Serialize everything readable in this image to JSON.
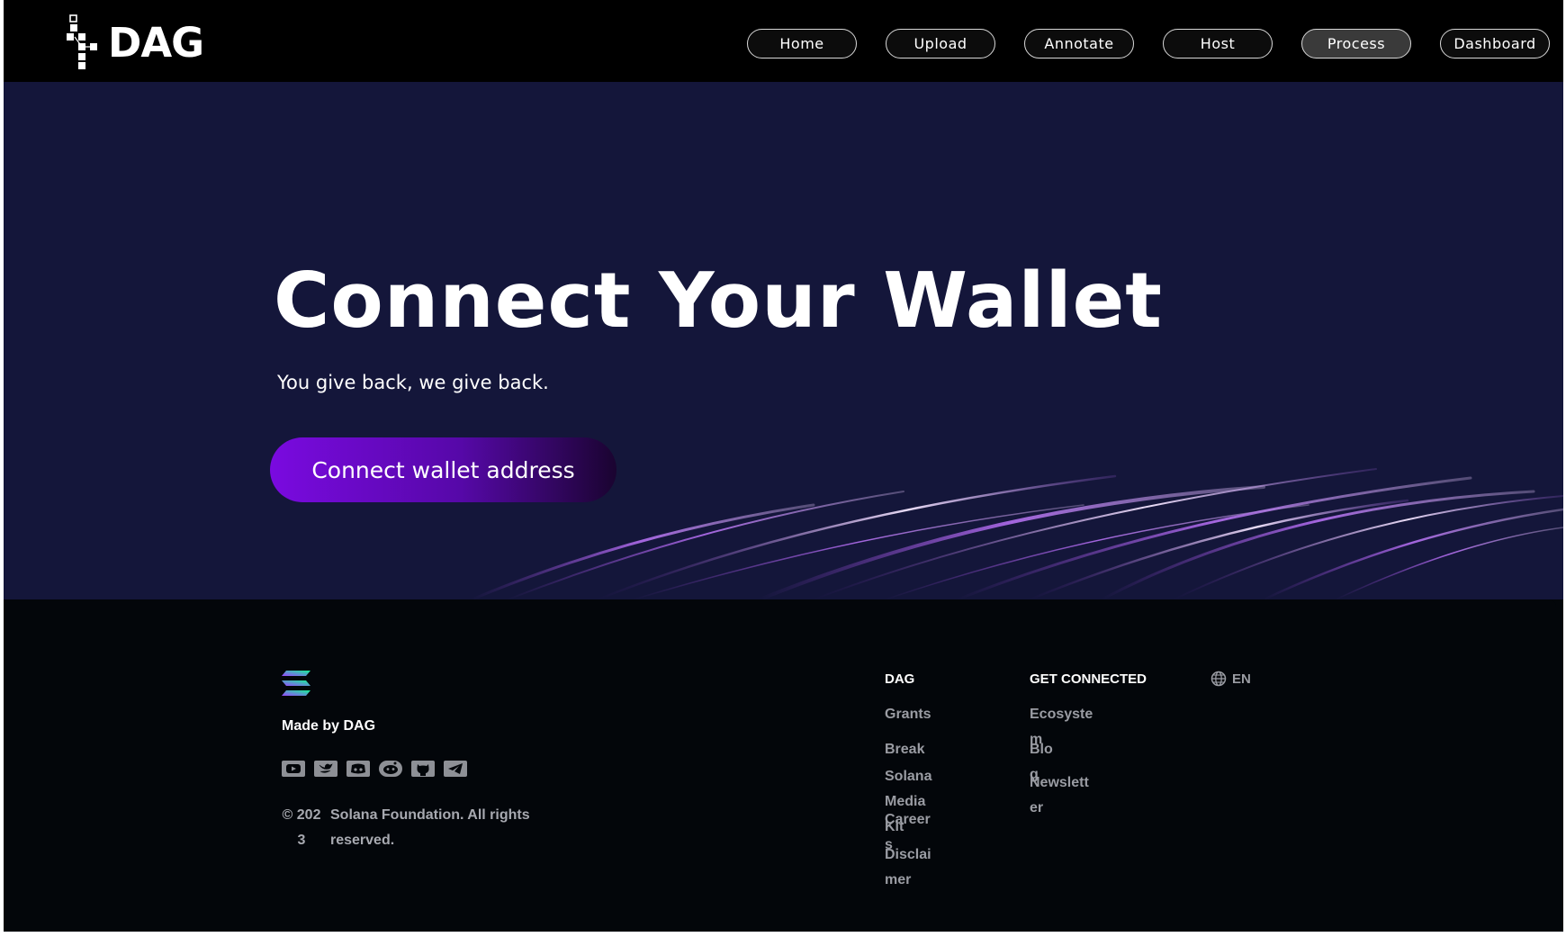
{
  "header": {
    "logo_text": "DAG",
    "nav": [
      {
        "label": "Home",
        "active": false
      },
      {
        "label": "Upload",
        "active": false
      },
      {
        "label": "Annotate",
        "active": false
      },
      {
        "label": "Host",
        "active": false
      },
      {
        "label": "Process",
        "active": true
      },
      {
        "label": "Dashboard",
        "active": false
      }
    ]
  },
  "hero": {
    "title": "Connect Your Wallet",
    "subtitle": "You give back, we give back.",
    "cta_label": "Connect wallet address"
  },
  "footer": {
    "logo_icon": "solana-logo-icon",
    "made_by": "Made by DAG",
    "social_icons": [
      "youtube-icon",
      "twitter-icon",
      "discord-icon",
      "reddit-icon",
      "github-icon",
      "telegram-icon"
    ],
    "copyright_year": "© 2023",
    "copyright_text": "Solana Foundation. All rights reserved.",
    "columns": [
      {
        "heading": "DAG",
        "links": [
          "Grants",
          "Break",
          "Solana Media Kit",
          "Careers",
          "Disclaimer"
        ]
      },
      {
        "heading": "GET CONNECTED",
        "links": [
          "Ecosystem",
          "Blog",
          "Newsletter"
        ]
      }
    ],
    "language": {
      "icon": "globe-icon",
      "label": "EN"
    }
  },
  "colors": {
    "header_bg": "#000000",
    "hero_bg": "#14163a",
    "footer_bg": "#03060a",
    "cta_gradient_start": "#7a0ae0",
    "cta_gradient_end": "#1a0430",
    "streak": "#b36ef0"
  }
}
